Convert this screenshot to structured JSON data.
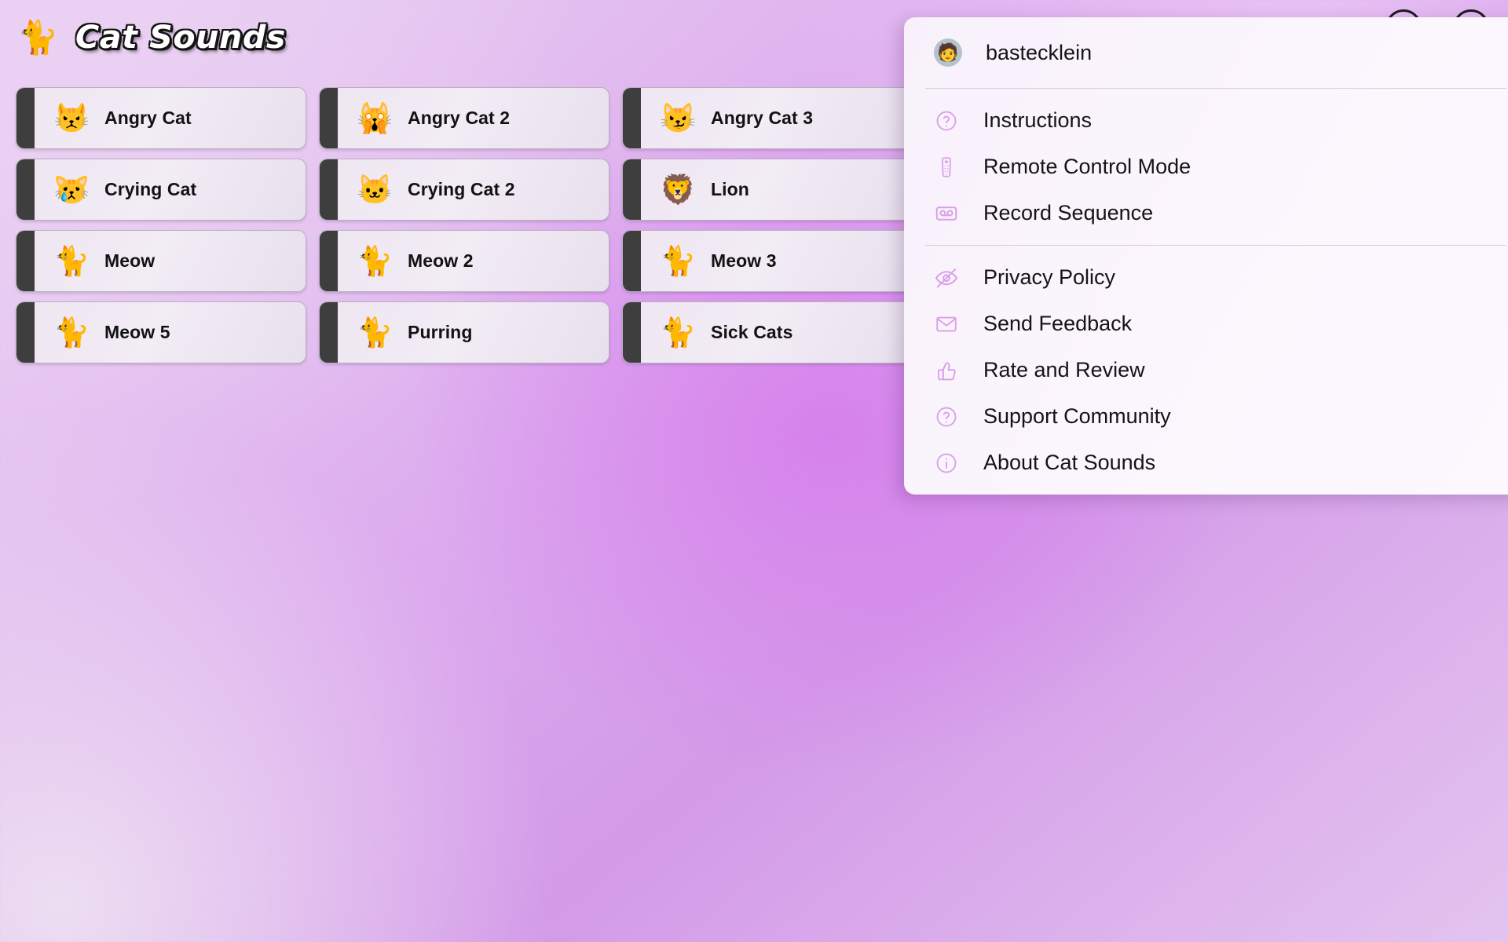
{
  "header": {
    "brand_emoji": "🐈",
    "brand_emoji_name": "kitten-walking-icon",
    "title": "Cat Sounds",
    "actions": [
      {
        "name": "help-circle-icon",
        "label": ""
      },
      {
        "name": "account-circle-icon",
        "label": ""
      }
    ]
  },
  "sounds": [
    {
      "label": "Angry Cat",
      "emoji": "😾",
      "icon_name": "angry-cat-icon"
    },
    {
      "label": "Angry Cat 2",
      "emoji": "🙀",
      "icon_name": "angry-cat-2-icon"
    },
    {
      "label": "Angry Cat 3",
      "emoji": "😼",
      "icon_name": "angry-cat-3-icon"
    },
    {
      "label": "",
      "emoji": "",
      "icon_name": ""
    },
    {
      "label": "Crying Cat",
      "emoji": "😿",
      "icon_name": "crying-cat-icon"
    },
    {
      "label": "Crying Cat 2",
      "emoji": "🐱",
      "icon_name": "crying-cat-2-icon"
    },
    {
      "label": "Lion",
      "emoji": "🦁",
      "icon_name": "lion-icon"
    },
    {
      "label": "",
      "emoji": "",
      "icon_name": ""
    },
    {
      "label": "Meow",
      "emoji": "🐈",
      "icon_name": "meow-icon"
    },
    {
      "label": "Meow 2",
      "emoji": "🐈",
      "icon_name": "meow-2-icon"
    },
    {
      "label": "Meow 3",
      "emoji": "🐈",
      "icon_name": "meow-3-icon"
    },
    {
      "label": "",
      "emoji": "",
      "icon_name": ""
    },
    {
      "label": "Meow 5",
      "emoji": "🐈",
      "icon_name": "meow-5-icon"
    },
    {
      "label": "Purring",
      "emoji": "🐈",
      "icon_name": "purring-icon"
    },
    {
      "label": "Sick Cats",
      "emoji": "🐈",
      "icon_name": "sick-cats-icon"
    },
    {
      "label": "",
      "emoji": "",
      "icon_name": ""
    }
  ],
  "menu": {
    "account": {
      "username": "bastecklein",
      "avatar_emoji": "🧑",
      "avatar_name": "user-avatar"
    },
    "groups": [
      {
        "items": [
          {
            "label": "Instructions",
            "icon": "help-circle-icon"
          },
          {
            "label": "Remote Control Mode",
            "icon": "remote-control-icon"
          },
          {
            "label": "Record Sequence",
            "icon": "cassette-record-icon"
          }
        ]
      },
      {
        "items": [
          {
            "label": "Privacy Policy",
            "icon": "eye-off-icon"
          },
          {
            "label": "Send Feedback",
            "icon": "mail-envelope-icon"
          },
          {
            "label": "Rate and Review",
            "icon": "thumbs-up-icon"
          },
          {
            "label": "Support Community",
            "icon": "question-circle-icon"
          },
          {
            "label": "About Cat Sounds",
            "icon": "info-circle-icon"
          }
        ]
      }
    ]
  },
  "colors": {
    "background_accent": "#d680ec",
    "background_light": "#ead6f2",
    "menu_icon": "#da9fe8",
    "button_accent_bar": "#3e3e3e",
    "button_surface": "#efe8f2",
    "title_outline": "#141414"
  }
}
